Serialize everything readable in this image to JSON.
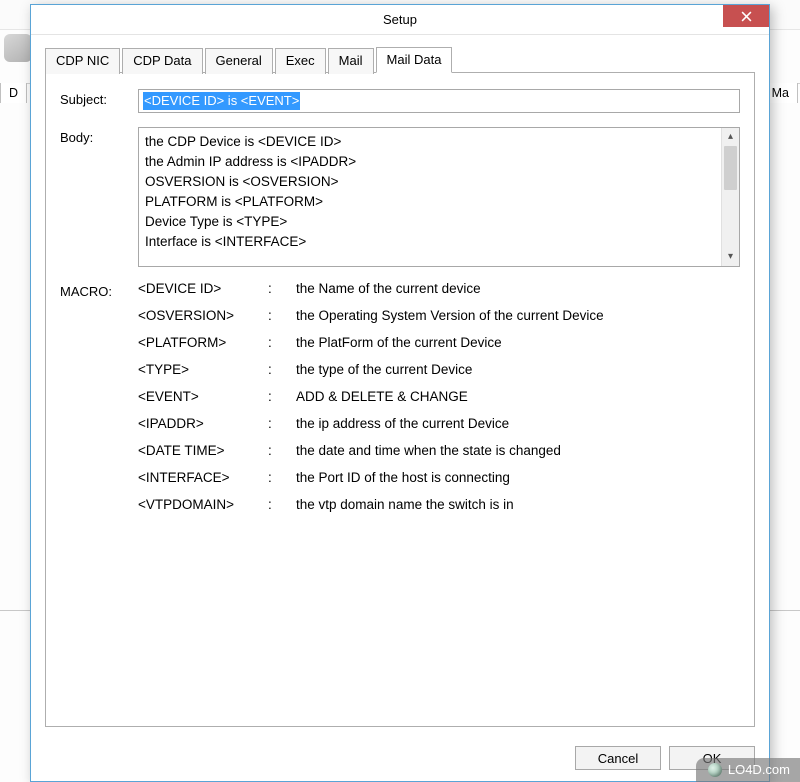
{
  "window": {
    "title": "Setup"
  },
  "back": {
    "tab_left": "D",
    "tab_right": "Ma"
  },
  "tabs": [
    {
      "id": "cdp-nic",
      "label": "CDP NIC"
    },
    {
      "id": "cdp-data",
      "label": "CDP Data"
    },
    {
      "id": "general",
      "label": "General"
    },
    {
      "id": "exec",
      "label": "Exec"
    },
    {
      "id": "mail",
      "label": "Mail"
    },
    {
      "id": "mail-data",
      "label": "Mail Data"
    }
  ],
  "active_tab": "mail-data",
  "form": {
    "subject_label": "Subject:",
    "subject_value": "<DEVICE ID> is <EVENT>",
    "body_label": "Body:",
    "body_value": "the CDP Device is <DEVICE ID>\nthe Admin IP address is <IPADDR>\nOSVERSION is <OSVERSION>\nPLATFORM is <PLATFORM>\nDevice Type is <TYPE>\nInterface is <INTERFACE>"
  },
  "macro_label": "MACRO:",
  "macros": [
    {
      "key": "<DEVICE ID>",
      "desc": "the Name of the current device"
    },
    {
      "key": "<OSVERSION>",
      "desc": "the Operating System Version of the current Device"
    },
    {
      "key": "<PLATFORM>",
      "desc": "the PlatForm of the current Device"
    },
    {
      "key": "<TYPE>",
      "desc": "the type of the current Device"
    },
    {
      "key": "<EVENT>",
      "desc": "ADD & DELETE & CHANGE"
    },
    {
      "key": "<IPADDR>",
      "desc": "the ip address of the current Device"
    },
    {
      "key": "<DATE TIME>",
      "desc": "the date and time when the state is changed"
    },
    {
      "key": "<INTERFACE>",
      "desc": "the Port ID of the host is connecting"
    },
    {
      "key": "<VTPDOMAIN>",
      "desc": "the vtp domain name the switch is in"
    }
  ],
  "buttons": {
    "cancel": "Cancel",
    "ok": "OK"
  },
  "watermark": "LO4D.com"
}
